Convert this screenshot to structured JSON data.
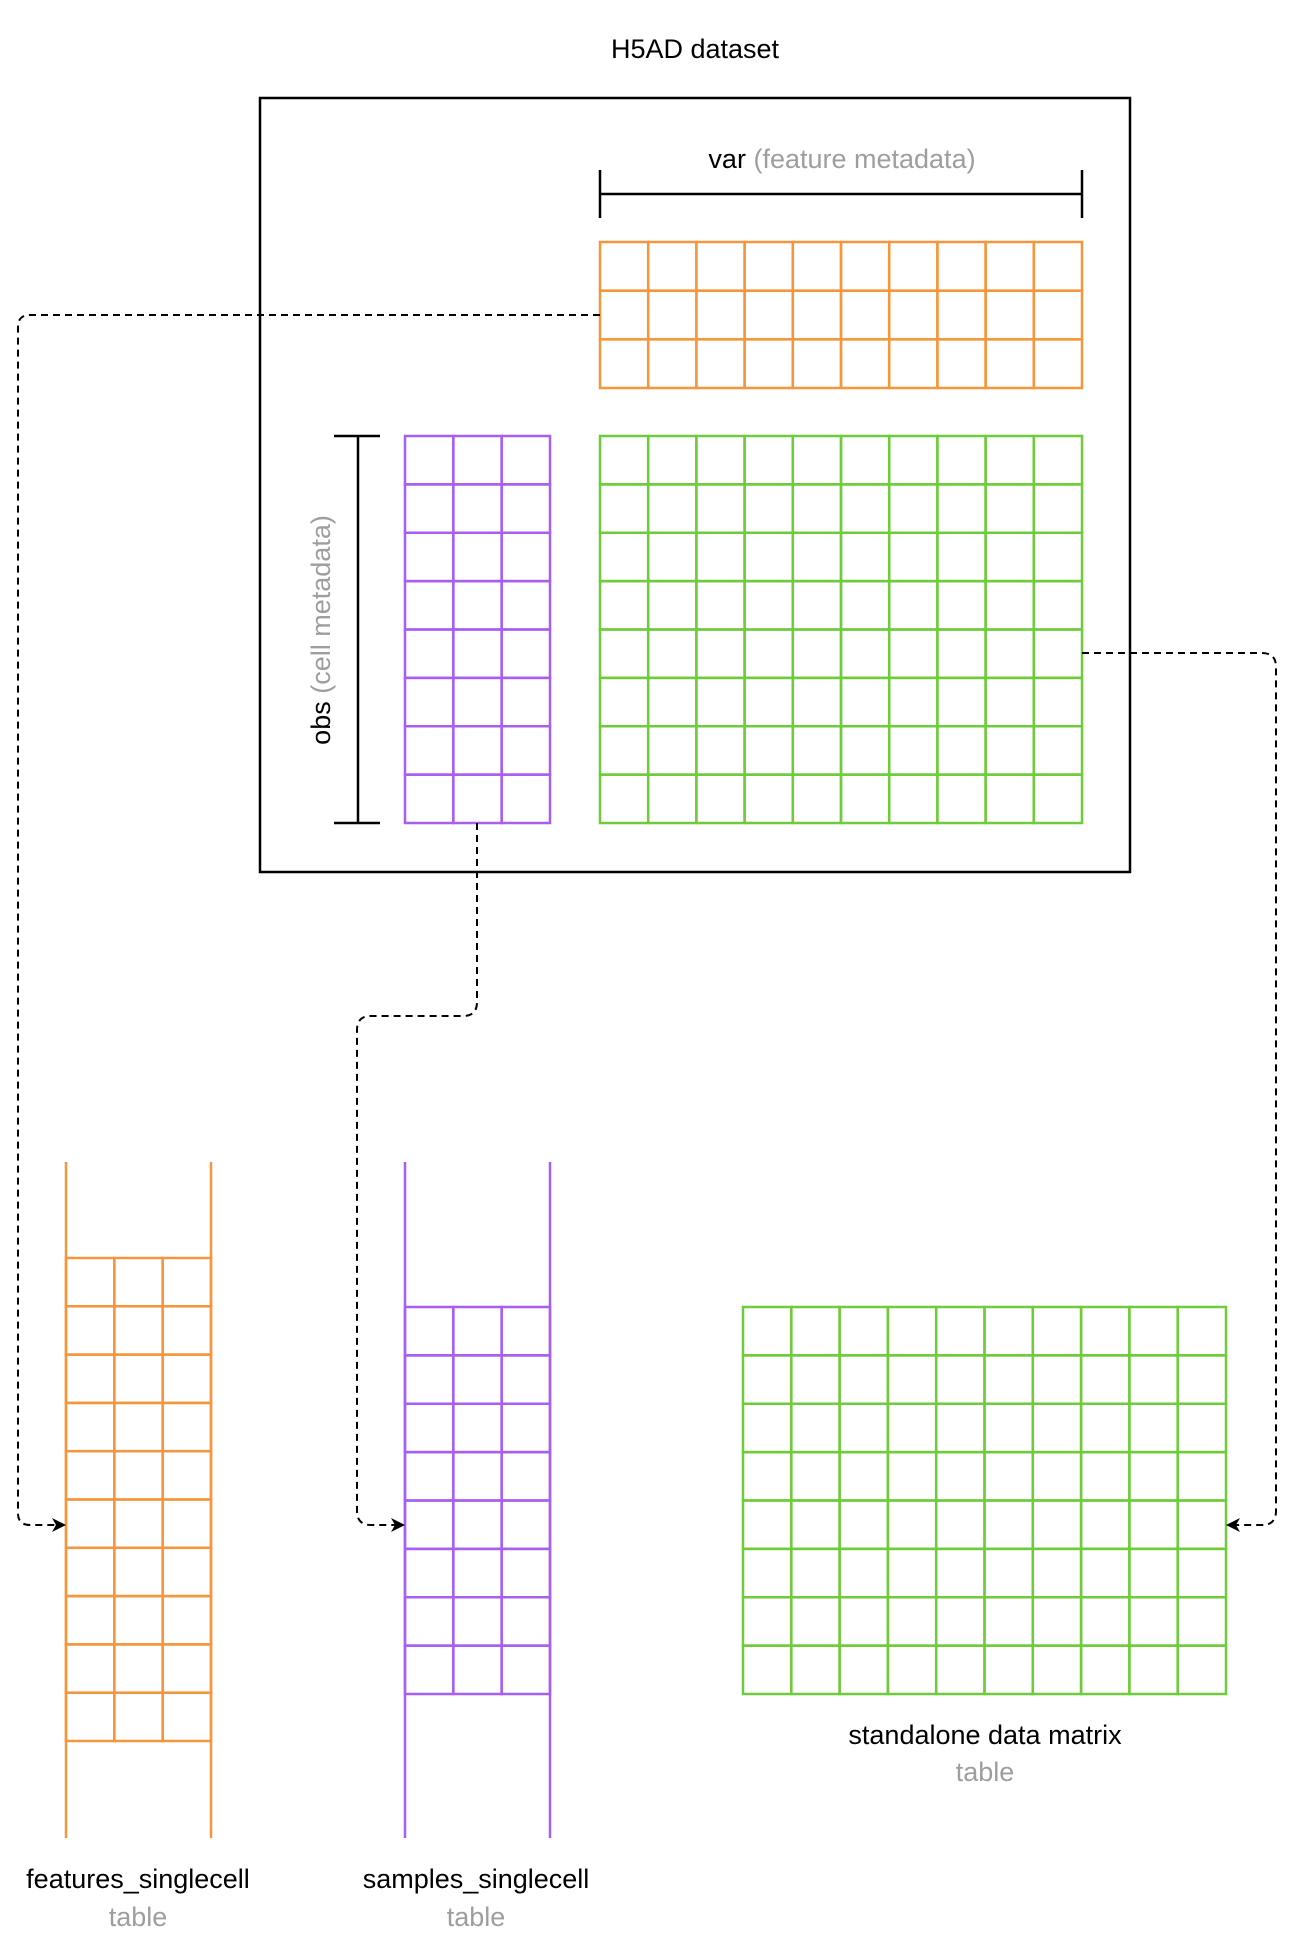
{
  "title": "H5AD dataset",
  "var_label": {
    "name": "var",
    "note": "(feature metadata)"
  },
  "obs_label": {
    "name": "obs",
    "note": "(cell metadata)"
  },
  "tables": {
    "features": {
      "name": "features_singlecell",
      "kind": "table"
    },
    "samples": {
      "name": "samples_singlecell",
      "kind": "table"
    },
    "matrix": {
      "name": "standalone data matrix",
      "kind": "table"
    }
  },
  "colors": {
    "orange": "#f5963c",
    "purple": "#a95ef2",
    "green": "#6ecb3a",
    "black": "#000000",
    "muted": "#9e9e9e"
  },
  "grids": {
    "var_grid": {
      "rows": 3,
      "cols": 10
    },
    "obs_grid": {
      "rows": 8,
      "cols": 3
    },
    "x_grid": {
      "rows": 8,
      "cols": 10
    },
    "features_grid": {
      "rows": 10,
      "cols": 3
    },
    "samples_grid": {
      "rows": 8,
      "cols": 3
    },
    "matrix_grid": {
      "rows": 8,
      "cols": 10
    }
  }
}
